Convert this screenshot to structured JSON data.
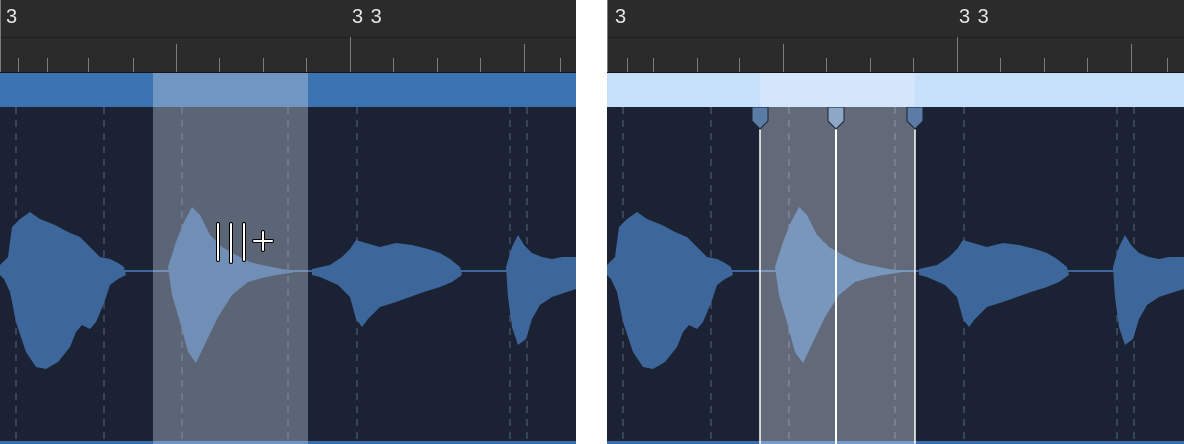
{
  "left_panel": {
    "ruler": {
      "start_label": "3",
      "mid_label": "3 3"
    },
    "state": "pointer-over-waveform",
    "cursor": "flex-marker-add-icon"
  },
  "right_panel": {
    "ruler": {
      "start_label": "3",
      "mid_label": "3 3"
    },
    "state": "flex-markers-created",
    "markers": [
      "flex-marker-left",
      "flex-marker-center",
      "flex-marker-right"
    ]
  },
  "colors": {
    "track_background": "#1a2233",
    "waveform": "#3d669b",
    "region_bar": "#3a72b2",
    "region_bar_selected": "#c6e0fb",
    "ruler_background": "#2b2b2b"
  }
}
